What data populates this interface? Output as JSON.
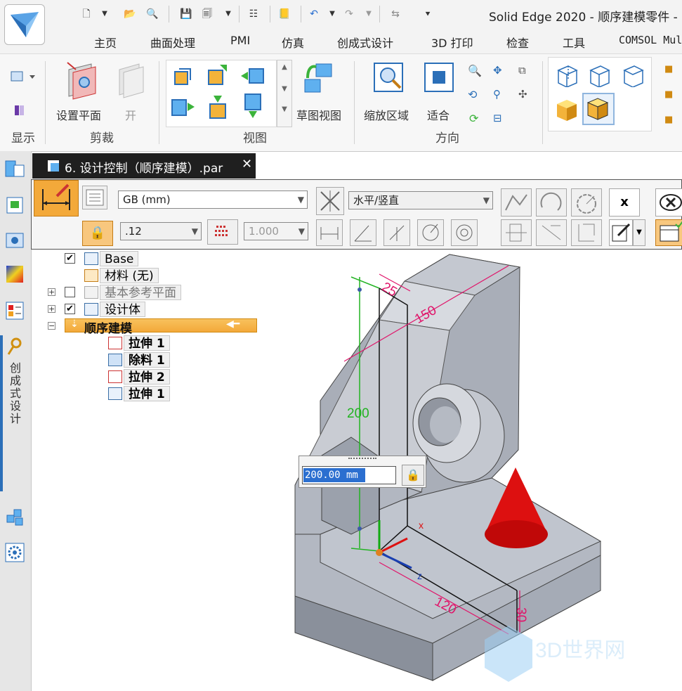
{
  "window": {
    "title": "Solid Edge 2020 - 顺序建模零件 -"
  },
  "ribbon_tabs": [
    "主页",
    "曲面处理",
    "PMI",
    "仿真",
    "创成式设计",
    "3D 打印",
    "检查",
    "工具",
    "COMSOL Mul"
  ],
  "ribbon": {
    "groups": [
      "显示",
      "剪裁",
      "视图",
      "方向"
    ],
    "buttons": {
      "set_plane": "设置平面",
      "open": "开",
      "sketch_view": "草图视图",
      "zoom_area": "缩放区域",
      "fit": "适合"
    }
  },
  "left_bar": {
    "vertical_label": "创成式设计"
  },
  "document_tab": {
    "title": "6. 设计控制（顺序建模）.par",
    "close_glyph": "✕"
  },
  "command_bar": {
    "standard": "GB (mm)",
    "precision": ".12",
    "scale": "1.000",
    "orientation": "水平/竖直",
    "close_button": "x"
  },
  "tree": {
    "items": [
      {
        "label": "Base",
        "checked": true
      },
      {
        "label": "材料 (无)"
      },
      {
        "label": "基本参考平面",
        "checked": false
      },
      {
        "label": "设计体",
        "checked": true
      },
      {
        "label": "顺序建模"
      },
      {
        "label": "拉伸 1"
      },
      {
        "label": "除料 1"
      },
      {
        "label": "拉伸 2"
      },
      {
        "label": "拉伸 1"
      }
    ]
  },
  "dimension_input": {
    "value": "200.00 mm"
  },
  "viewport": {
    "dims": [
      "25",
      "150",
      "200",
      "120",
      "30"
    ],
    "axes": [
      "x",
      "z"
    ],
    "watermark": "3D世界网"
  },
  "colors": {
    "accent_orange": "#f3a93a",
    "dimension_pink": "#e0156a",
    "sketch_green": "#22b322",
    "part_gray": "#b9bec7",
    "cone_red": "#dd1010"
  }
}
